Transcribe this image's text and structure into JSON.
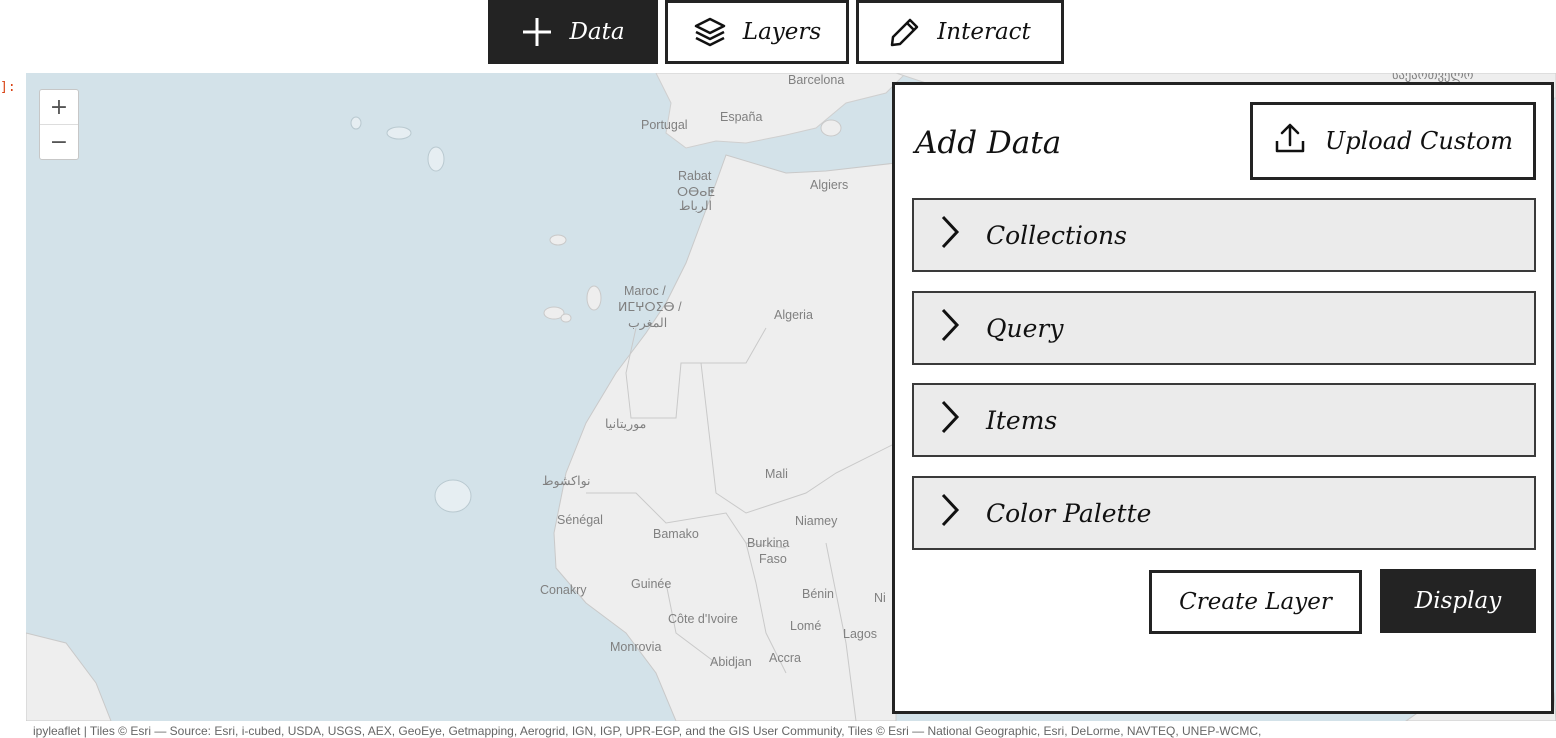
{
  "cell_prompt": "]:",
  "toolbar": {
    "tabs": [
      {
        "label": "Data",
        "icon": "plus-icon",
        "active": true
      },
      {
        "label": "Layers",
        "icon": "layers-icon",
        "active": false
      },
      {
        "label": "Interact",
        "icon": "pencil-icon",
        "active": false
      }
    ]
  },
  "map": {
    "zoom_in": "+",
    "zoom_out": "−",
    "labels": {
      "barcelona": "Barcelona",
      "portugal": "Portugal",
      "espana": "España",
      "rabat": "Rabat",
      "rabat_tifinagh": "ⵔⴱⴰⵟ",
      "rabat_arabic": "الرباط",
      "algiers": "Algiers",
      "maroc": "Maroc /",
      "maroc_tifinagh": "ⵍⵎⵖⵔⵉⴱ /",
      "maroc_arabic": "المغرب",
      "algeria": "Algeria",
      "mauritania": "موريتانيا",
      "nouakchott": "نواكشوط",
      "mali": "Mali",
      "senegal": "Sénégal",
      "bamako": "Bamako",
      "niamey": "Niamey",
      "burkina": "Burkina",
      "faso": "Faso",
      "conakry": "Conakry",
      "guinee": "Guinée",
      "benin": "Bénin",
      "ni": "Ni",
      "cote": "Côte d'Ivoire",
      "lome": "Lomé",
      "lagos": "Lagos",
      "monrovia": "Monrovia",
      "abidjan": "Abidjan",
      "accra": "Accra",
      "georgian": "საქართველო"
    },
    "attribution": "ipyleaflet | Tiles © Esri — Source: Esri, i-cubed, USDA, USGS, AEX, GeoEye, Getmapping, Aerogrid, IGN, IGP, UPR-EGP, and the GIS User Community, Tiles © Esri — National Geographic, Esri, DeLorme, NAVTEQ, UNEP-WCMC,"
  },
  "panel": {
    "title": "Add Data",
    "upload_label": "Upload Custom",
    "sections": [
      "Collections",
      "Query",
      "Items",
      "Color Palette"
    ],
    "create_label": "Create Layer",
    "display_label": "Display"
  }
}
